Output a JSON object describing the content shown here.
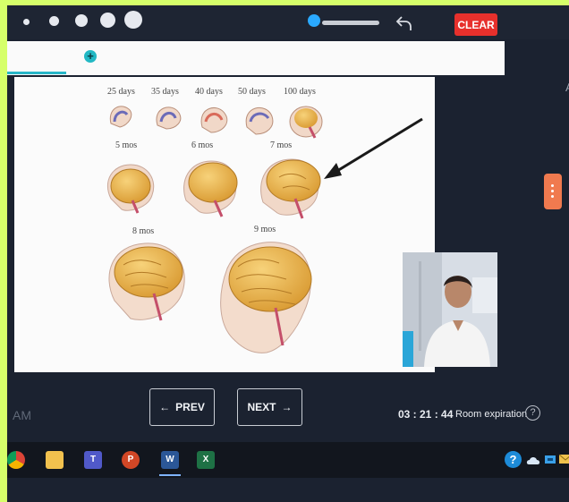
{
  "toolbar": {
    "clear_label": "CLEAR",
    "clear_color": "#e7302c",
    "brush_sizes": [
      "size-1",
      "size-2",
      "size-3",
      "size-4",
      "size-5"
    ],
    "undo_icon": "undo-icon",
    "slider_color": "#2aa9ff"
  },
  "tabbar": {
    "add_icon": "plus-icon",
    "accent": "#27b6c8"
  },
  "slide": {
    "row1_labels": [
      "25 days",
      "35 days",
      "40 days",
      "50 days",
      "100 days"
    ],
    "row2_labels": [
      "5 mos",
      "6 mos",
      "7 mos"
    ],
    "row3_labels": [
      "8 mos",
      "9 mos"
    ],
    "annotation": "arrow pointing to 7 mos brain"
  },
  "right_edge_text": "A",
  "side_tab_icon": "more-vertical-icon",
  "nav": {
    "prev_label": "PREV",
    "next_label": "NEXT"
  },
  "status": {
    "am_text": "AM",
    "timer": "03 : 21 : 44",
    "room_expiration_label": "Room expiration"
  },
  "taskbar": {
    "apps": [
      "chrome-icon",
      "file-explorer-icon",
      "teams-icon",
      "powerpoint-icon",
      "word-icon",
      "excel-icon"
    ],
    "tray": [
      "help-icon",
      "onedrive-icon",
      "network-icon",
      "mail-icon"
    ]
  }
}
